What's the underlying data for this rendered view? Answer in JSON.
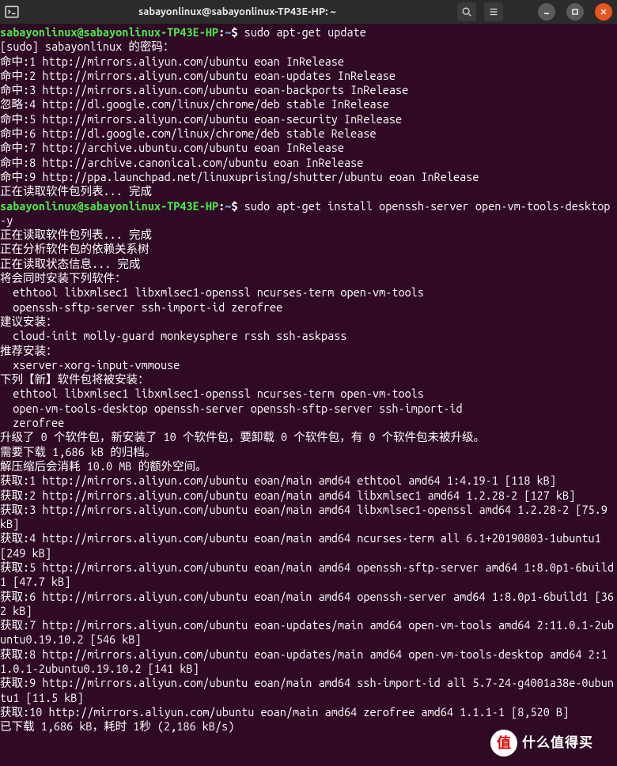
{
  "titlebar": {
    "title": "sabayonlinux@sabayonlinux-TP43E-HP: ~"
  },
  "prompt": {
    "user": "sabayonlinux@sabayonlinux-TP43E-HP",
    "colon": ":",
    "path": "~",
    "dollar": "$ "
  },
  "cmd1": "sudo apt-get update",
  "out_update": "[sudo] sabayonlinux 的密码：\n命中:1 http://mirrors.aliyun.com/ubuntu eoan InRelease\n命中:2 http://mirrors.aliyun.com/ubuntu eoan-updates InRelease\n命中:3 http://mirrors.aliyun.com/ubuntu eoan-backports InRelease\n忽略:4 http://dl.google.com/linux/chrome/deb stable InRelease\n命中:5 http://mirrors.aliyun.com/ubuntu eoan-security InRelease\n命中:6 http://dl.google.com/linux/chrome/deb stable Release\n命中:7 http://archive.ubuntu.com/ubuntu eoan InRelease\n命中:8 http://archive.canonical.com/ubuntu eoan InRelease\n命中:9 http://ppa.launchpad.net/linuxuprising/shutter/ubuntu eoan InRelease\n正在读取软件包列表... 完成",
  "cmd2": "sudo apt-get install openssh-server open-vm-tools-desktop -y",
  "out_install": "正在读取软件包列表... 完成\n正在分析软件包的依赖关系树       \n正在读取状态信息... 完成       \n将会同时安装下列软件：\n  ethtool libxmlsec1 libxmlsec1-openssl ncurses-term open-vm-tools\n  openssh-sftp-server ssh-import-id zerofree\n建议安装：\n  cloud-init molly-guard monkeysphere rssh ssh-askpass\n推荐安装：\n  xserver-xorg-input-vmmouse\n下列【新】软件包将被安装：\n  ethtool libxmlsec1 libxmlsec1-openssl ncurses-term open-vm-tools\n  open-vm-tools-desktop openssh-server openssh-sftp-server ssh-import-id\n  zerofree\n升级了 0 个软件包，新安装了 10 个软件包，要卸载 0 个软件包，有 0 个软件包未被升级。\n需要下载 1,686 kB 的归档。\n解压缩后会消耗 10.0 MB 的额外空间。\n获取:1 http://mirrors.aliyun.com/ubuntu eoan/main amd64 ethtool amd64 1:4.19-1 [118 kB]\n获取:2 http://mirrors.aliyun.com/ubuntu eoan/main amd64 libxmlsec1 amd64 1.2.28-2 [127 kB]\n获取:3 http://mirrors.aliyun.com/ubuntu eoan/main amd64 libxmlsec1-openssl amd64 1.2.28-2 [75.9 kB]\n获取:4 http://mirrors.aliyun.com/ubuntu eoan/main amd64 ncurses-term all 6.1+20190803-1ubuntu1 [249 kB]\n获取:5 http://mirrors.aliyun.com/ubuntu eoan/main amd64 openssh-sftp-server amd64 1:8.0p1-6build1 [47.7 kB]\n获取:6 http://mirrors.aliyun.com/ubuntu eoan/main amd64 openssh-server amd64 1:8.0p1-6build1 [362 kB]\n获取:7 http://mirrors.aliyun.com/ubuntu eoan-updates/main amd64 open-vm-tools amd64 2:11.0.1-2ubuntu0.19.10.2 [546 kB]\n获取:8 http://mirrors.aliyun.com/ubuntu eoan-updates/main amd64 open-vm-tools-desktop amd64 2:11.0.1-2ubuntu0.19.10.2 [141 kB]\n获取:9 http://mirrors.aliyun.com/ubuntu eoan/main amd64 ssh-import-id all 5.7-24-g4001a38e-0ubuntu1 [11.5 kB]\n获取:10 http://mirrors.aliyun.com/ubuntu eoan/main amd64 zerofree amd64 1.1.1-1 [8,520 B]\n已下载 1,686 kB，耗时 1秒 (2,186 kB/s)",
  "watermark": {
    "circle": "值",
    "text": "什么值得买"
  }
}
